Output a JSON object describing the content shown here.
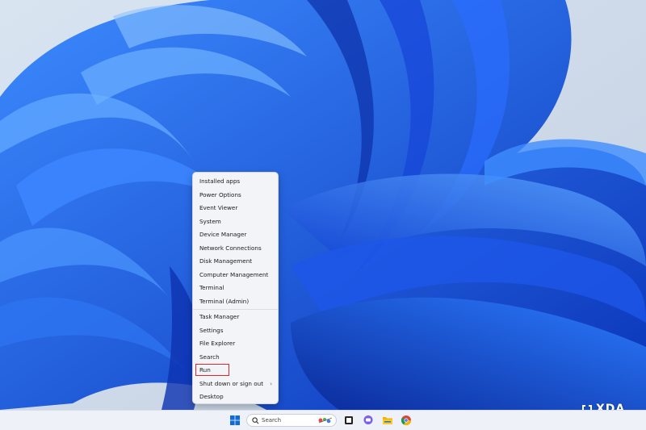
{
  "menu": {
    "items_top": [
      {
        "label": "Installed apps"
      },
      {
        "label": "Power Options"
      },
      {
        "label": "Event Viewer"
      },
      {
        "label": "System"
      },
      {
        "label": "Device Manager"
      },
      {
        "label": "Network Connections"
      },
      {
        "label": "Disk Management"
      },
      {
        "label": "Computer Management"
      },
      {
        "label": "Terminal"
      },
      {
        "label": "Terminal (Admin)"
      }
    ],
    "items_bottom": [
      {
        "label": "Task Manager"
      },
      {
        "label": "Settings"
      },
      {
        "label": "File Explorer"
      },
      {
        "label": "Search"
      },
      {
        "label": "Run",
        "highlighted": true
      },
      {
        "label": "Shut down or sign out",
        "submenu": true
      },
      {
        "label": "Desktop"
      }
    ],
    "highlight_color": "#e0262d"
  },
  "taskbar": {
    "search_placeholder": "Search",
    "icons": [
      "windows-start-icon",
      "search-icon",
      "task-view-icon",
      "chat-icon",
      "file-explorer-icon",
      "chrome-icon"
    ]
  },
  "watermark": {
    "text": "XDA"
  },
  "colors": {
    "wallpaper_blue": "#1f5fe0",
    "accent": "#0067c0"
  }
}
